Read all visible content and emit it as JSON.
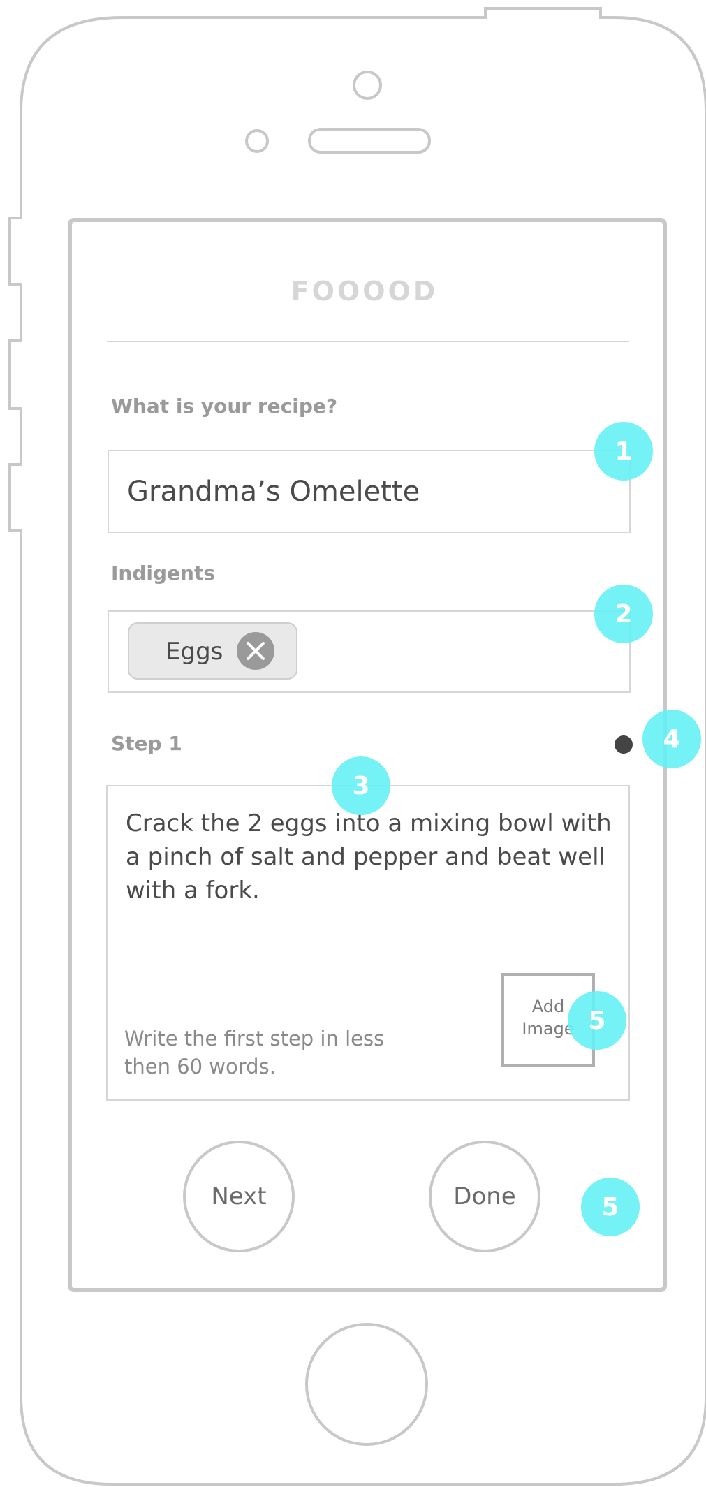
{
  "app": {
    "title": "FOOOOD"
  },
  "recipe": {
    "label": "What is your recipe?",
    "value": "Grandma’s Omelette"
  },
  "ingredients": {
    "label": "Indigents",
    "tags": [
      {
        "label": "Eggs"
      }
    ]
  },
  "step": {
    "label": "Step 1",
    "text": "Crack the 2 eggs into a mixing bowl with a pinch of salt and pepper and beat well with a fork.",
    "hint": "Write the first step in less then 60 words.",
    "add_image_line1": "Add",
    "add_image_line2": "Image"
  },
  "buttons": {
    "next": "Next",
    "done": "Done"
  },
  "annotations": [
    "1",
    "2",
    "3",
    "4",
    "5",
    "5"
  ],
  "colors": {
    "annotation": "#66f1f5",
    "outline": "#c8c8c8",
    "tag_bg": "#e9e9e9"
  }
}
